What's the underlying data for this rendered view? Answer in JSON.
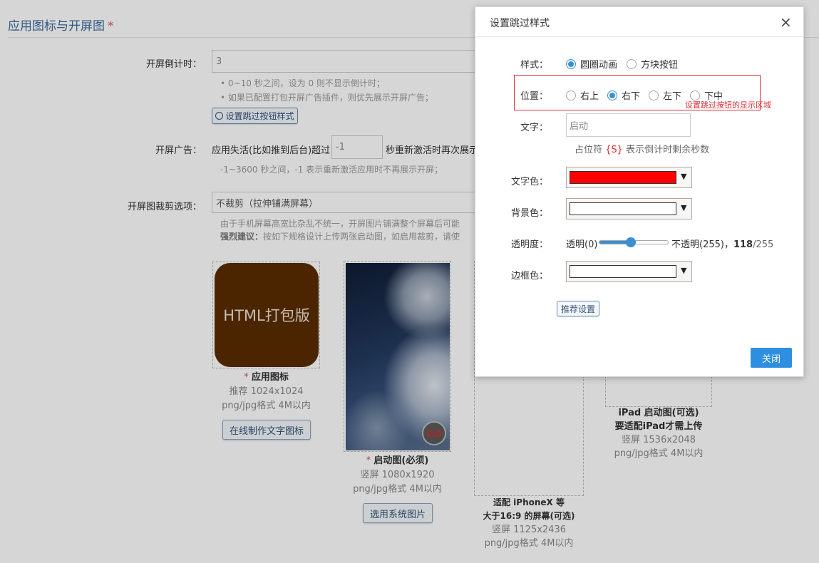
{
  "section": {
    "title": "应用图标与开屏图",
    "required_mark": "*"
  },
  "countdown": {
    "label": "开屏倒计时：",
    "value": "3",
    "hint1": "• 0~10 秒之间，设为 0 则不显示倒计时；",
    "hint2": "• 如果已配置打包开屏广告插件，则优先展示开屏广告；",
    "skip_button": "设置跳过按钮样式"
  },
  "ad": {
    "label": "开屏广告：",
    "prefix": "应用失活(比如推到后台)超过",
    "value": "-1",
    "suffix": "秒重新激活时再次展示",
    "hint": "-1~3600 秒之间，-1 表示重新激活应用时不再展示开屏；"
  },
  "crop": {
    "label": "开屏图裁剪选项：",
    "value": "不裁剪（拉伸铺满屏幕）",
    "hint1": "由于手机屏幕高宽比杂乱不统一，开屏图片铺满整个屏幕后可能",
    "hint2_bold": "强烈建议：",
    "hint2": "按如下规格设计上传两张启动图，如启用裁剪，请使"
  },
  "cards": {
    "icon": {
      "text": "HTML打包版",
      "req": "*",
      "title": "应用图标",
      "size": "推荐 1024x1024",
      "format": "png/jpg格式 4M以内",
      "button": "在线制作文字图标"
    },
    "splash": {
      "badge": "启动",
      "req": "*",
      "title": "启动图(必须)",
      "size": "竖屏 1080x1920",
      "format": "png/jpg格式 4M以内",
      "button": "选用系统图片"
    },
    "iphonex": {
      "title1": "适配 iPhoneX 等",
      "title2": "大于16:9 的屏幕(可选)",
      "size": "竖屏 1125x2436",
      "format": "png/jpg格式 4M以内"
    },
    "ipad": {
      "title1": "iPad 启动图(可选)",
      "title2": "要适配iPad才需上传",
      "size": "竖屏 1536x2048",
      "format": "png/jpg格式 4M以内"
    }
  },
  "modal": {
    "title": "设置跳过样式",
    "close": "×",
    "style_label": "样式：",
    "style_options": [
      "圆圈动画",
      "方块按钮"
    ],
    "position_label": "位置：",
    "position_options": [
      "右上",
      "右下",
      "左下",
      "下中"
    ],
    "position_note": "设置跳过按钮的显示区域",
    "text_label": "文字：",
    "text_placeholder": "启动",
    "text_hint_prefix": "占位符",
    "text_hint_token": "{S}",
    "text_hint_suffix": "表示倒计时剩余秒数",
    "text_color_label": "文字色：",
    "bg_color_label": "背景色：",
    "opacity_label": "透明度：",
    "opacity_min": "透明(0)",
    "opacity_max": "不透明(255)，",
    "opacity_value": "118",
    "opacity_total": "/255",
    "border_color_label": "边框色：",
    "recommend_button": "推荐设置",
    "close_button": "关闭",
    "colors": {
      "text": "#ff0000",
      "background": "#ffffff",
      "border": "#ffffff"
    }
  }
}
